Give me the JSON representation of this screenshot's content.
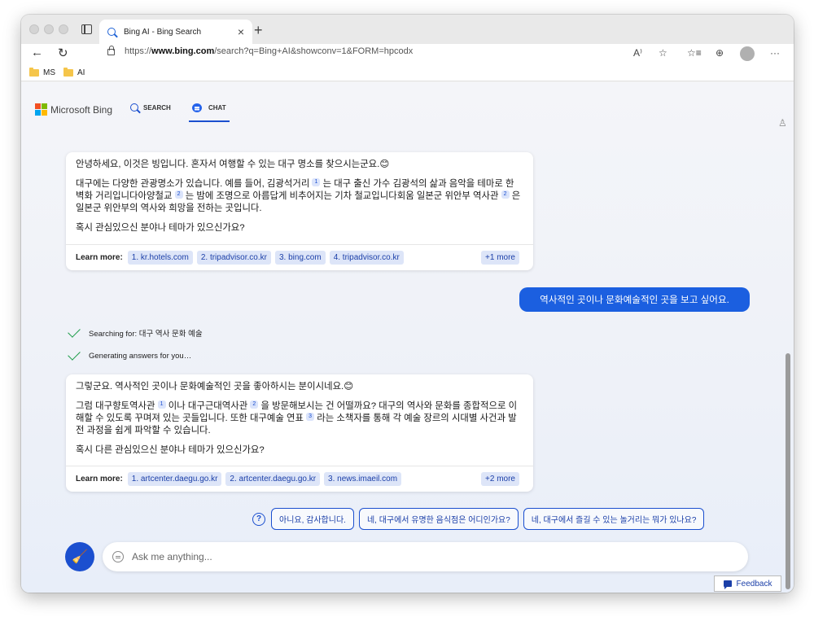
{
  "browser": {
    "tab_title": "Bing AI - Bing Search",
    "tab_close": "×",
    "new_tab": "+",
    "url_prefix": "https://",
    "url_domain": "www.bing.com",
    "url_path": "/search?q=Bing+AI&showconv=1&FORM=hpcodx",
    "back": "←",
    "reload": "↻",
    "read_aloud": "A⁾",
    "add_favorite": "☆",
    "favorites": "☆≡",
    "collections": "⊕",
    "more": "···",
    "bookmarks": [
      {
        "label": "MS"
      },
      {
        "label": "AI"
      }
    ]
  },
  "bing": {
    "logo_text": "Microsoft Bing",
    "logo_colors": [
      "#f25022",
      "#7fba00",
      "#00a4ef",
      "#ffb900"
    ],
    "tab_search": "SEARCH",
    "tab_chat": "CHAT",
    "accent": "#1b4fcf"
  },
  "conversation": {
    "msg1": {
      "p1": "안녕하세요, 이것은 빙입니다. 혼자서 여행할 수 있는 대구 명소를 찾으시는군요.😊",
      "p2a": "대구에는 다양한 관광명소가 있습니다. 예를 들어, 김광석거리",
      "p2b": "는 대구 출신 가수 김광석의 삶과 음악을 테마로 한 벽화 거리입니다아양철교",
      "p2c": "는 밤에 조명으로 아름답게 비추어지는 기차 철교입니다회움 일본군 위안부 역사관",
      "p2d": "은 일본군 위안부의 역사와 희망을 전하는 곳입니다.",
      "ref1": "1",
      "ref2": "2",
      "ref3": "2",
      "p3": "혹시 관심있으신 분야나 테마가 있으신가요?",
      "learn_more": "Learn more:",
      "links": [
        "1. kr.hotels.com",
        "2. tripadvisor.co.kr",
        "3. bing.com",
        "4. tripadvisor.co.kr"
      ],
      "more": "+1 more"
    },
    "user_msg": "역사적인 곳이나 문화예술적인 곳을 보고 싶어요.",
    "status1": "Searching for: 대구 역사 문화 예술",
    "status2": "Generating answers for you…",
    "msg2": {
      "p1": "그렇군요. 역사적인 곳이나 문화예술적인 곳을 좋아하시는 분이시네요.😊",
      "p2a": "그럼 대구향토역사관",
      "p2b": "이나 대구근대역사관",
      "p2c": "을 방문해보시는 건 어떨까요? 대구의 역사와 문화를 종합적으로 이해할 수 있도록 꾸며져 있는 곳들입니다. 또한 대구예술 연표",
      "p2d": "라는 소책자를 통해 각 예술 장르의 시대별 사건과 발전 과정을 쉽게 파악할 수 있습니다.",
      "ref1": "1",
      "ref2": "2",
      "ref3": "3",
      "p3": "혹시 다른 관심있으신 분야나 테마가 있으신가요?",
      "learn_more": "Learn more:",
      "links": [
        "1. artcenter.daegu.go.kr",
        "2. artcenter.daegu.go.kr",
        "3. news.imaeil.com"
      ],
      "more": "+2 more"
    }
  },
  "suggestions": {
    "help": "?",
    "items": [
      "아니요, 감사합니다.",
      "네, 대구에서 유명한 음식점은 어디인가요?",
      "네, 대구에서 즐길 수 있는 놀거리는 뭐가 있나요?"
    ]
  },
  "input": {
    "placeholder": "Ask me anything...",
    "new_topic_icon": "🧹"
  },
  "feedback_label": "Feedback",
  "person_icon": "♙"
}
